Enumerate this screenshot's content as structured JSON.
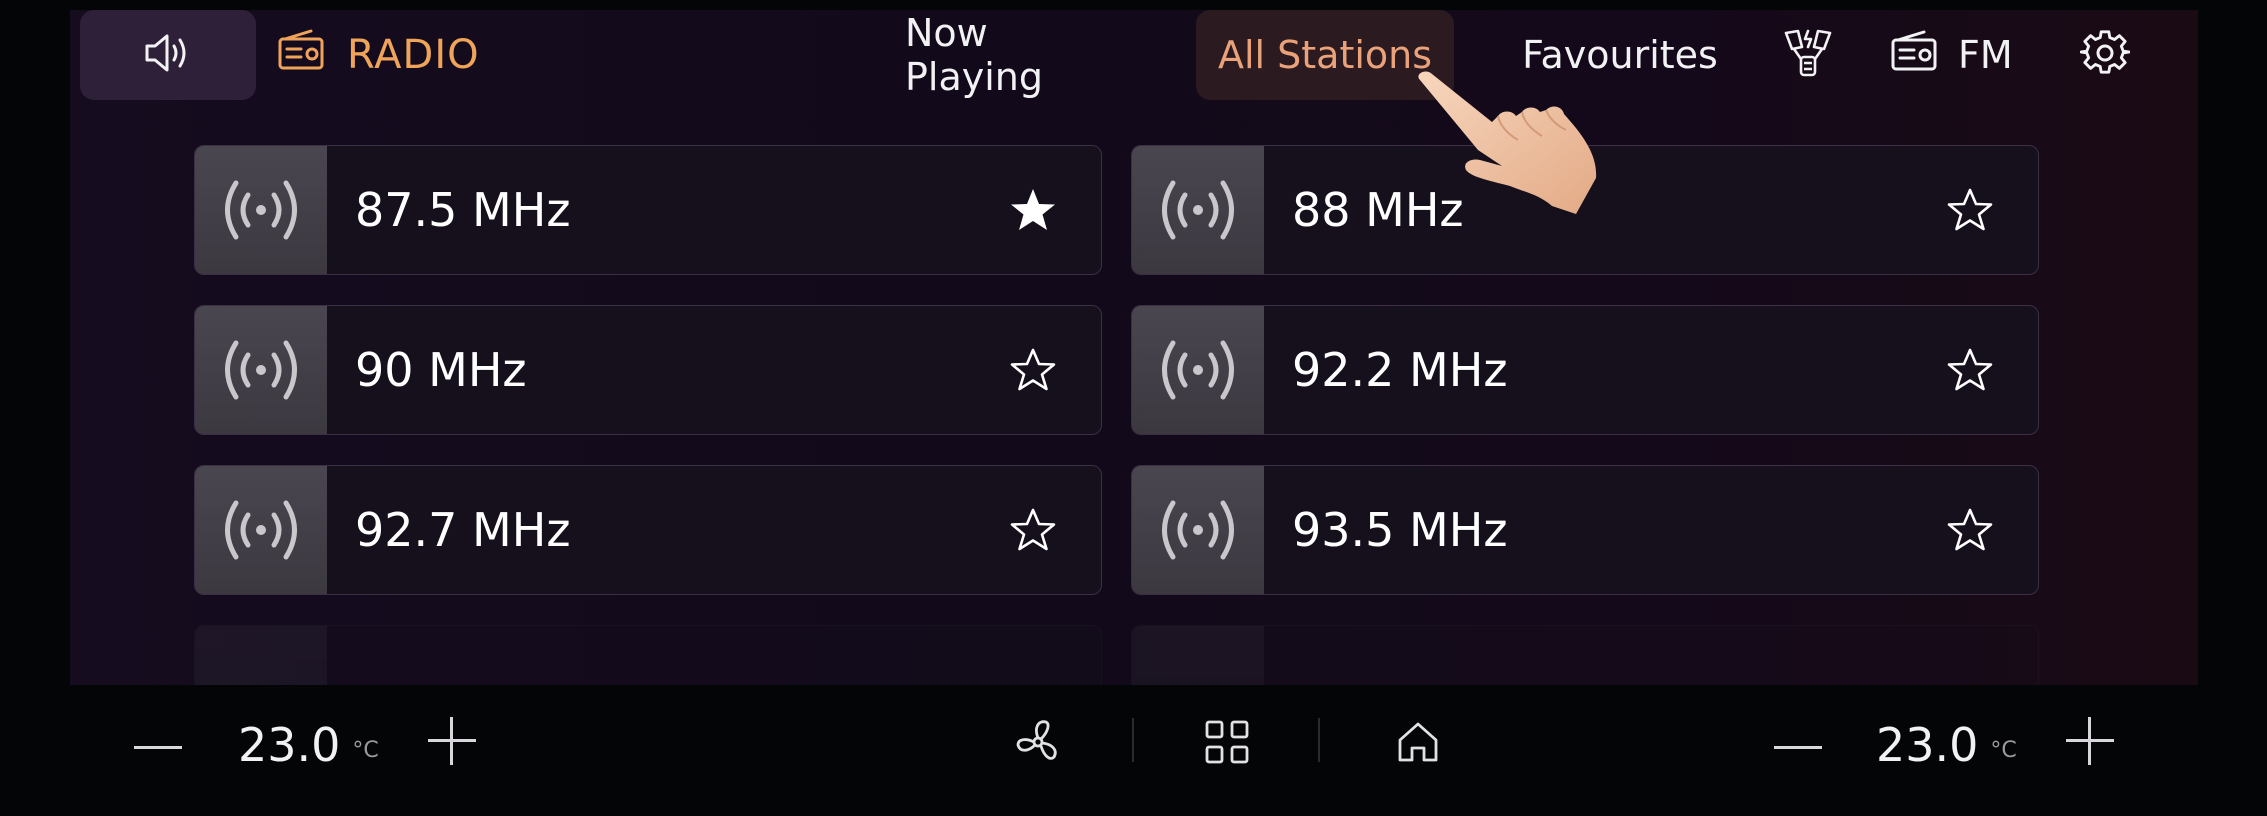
{
  "header": {
    "app_title": "RADIO",
    "tabs": [
      {
        "label": "Now Playing"
      },
      {
        "label": "All Stations",
        "active": true
      },
      {
        "label": "Favourites"
      }
    ],
    "band": "FM"
  },
  "stations": [
    {
      "freq": "87.5 MHz",
      "favourite": true
    },
    {
      "freq": "88 MHz",
      "favourite": false
    },
    {
      "freq": "90 MHz",
      "favourite": false
    },
    {
      "freq": "92.2 MHz",
      "favourite": false
    },
    {
      "freq": "92.7 MHz",
      "favourite": false
    },
    {
      "freq": "93.5 MHz",
      "favourite": false
    }
  ],
  "climate": {
    "left_temp": "23.0",
    "right_temp": "23.0",
    "unit": "°C"
  },
  "colors": {
    "accent": "#f0a45a",
    "active_tab_bg": "#2b1a20",
    "screen_bg": "#130b1b"
  }
}
